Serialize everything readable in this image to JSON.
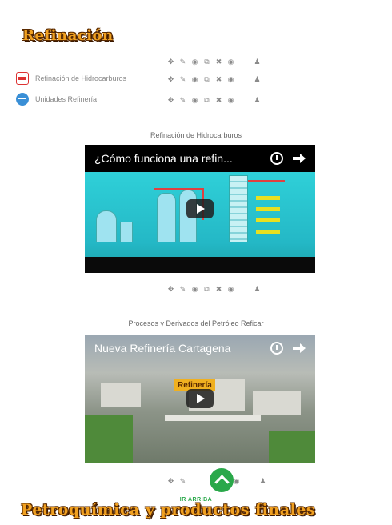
{
  "sections": {
    "top_title": "Refinación",
    "bottom_title": "Petroquímica y productos finales"
  },
  "toolbar": {
    "icons": [
      "move-icon",
      "edit-icon",
      "visibility-icon",
      "duplicate-icon",
      "delete-icon",
      "hide-icon",
      "user-icon"
    ],
    "glyphs": [
      "✥",
      "✎",
      "◉",
      "⧉",
      "✖",
      "◉",
      "♟"
    ]
  },
  "files": [
    {
      "label": "Refinación de Hidrocarburos",
      "icon": "pdf-file-icon"
    },
    {
      "label": "Unidades Refinería",
      "icon": "web-link-icon"
    }
  ],
  "videos": [
    {
      "caption": "Refinación de Hidrocarburos",
      "title": "¿Cómo funciona una refin..."
    },
    {
      "caption": "Procesos y Derivados del Petróleo Reficar",
      "title": "Nueva Refinería Cartagena",
      "overlay": "Refinería"
    }
  ],
  "back_to_top": {
    "label": "IR ARRIBA",
    "color": "#2aa84a"
  },
  "colors": {
    "section_title": "#f0a020",
    "section_outline": "#5a2a00"
  }
}
